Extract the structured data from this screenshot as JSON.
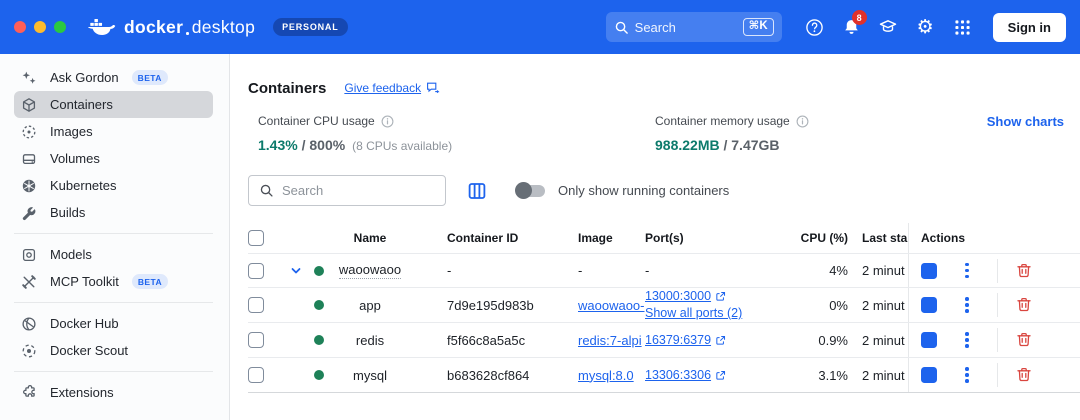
{
  "topbar": {
    "wordmark_bold": "docker",
    "wordmark_light": "desktop",
    "plan_badge": "PERSONAL",
    "search_placeholder": "Search",
    "search_shortcut": "⌘K",
    "notification_count": "8",
    "sign_in": "Sign in"
  },
  "sidebar": {
    "groups": [
      {
        "items": [
          {
            "label": "Ask Gordon",
            "icon": "sparkles",
            "badge": "BETA"
          },
          {
            "label": "Containers",
            "icon": "container-cube",
            "selected": true
          },
          {
            "label": "Images",
            "icon": "image-circle"
          },
          {
            "label": "Volumes",
            "icon": "volume-drive"
          },
          {
            "label": "Kubernetes",
            "icon": "kubernetes-wheel"
          },
          {
            "label": "Builds",
            "icon": "wrench"
          }
        ]
      },
      {
        "items": [
          {
            "label": "Models",
            "icon": "model-chip"
          },
          {
            "label": "MCP Toolkit",
            "icon": "tools",
            "badge": "BETA"
          }
        ]
      },
      {
        "items": [
          {
            "label": "Docker Hub",
            "icon": "docker-hub-globe"
          },
          {
            "label": "Docker Scout",
            "icon": "scout-target"
          }
        ]
      },
      {
        "items": [
          {
            "label": "Extensions",
            "icon": "puzzle"
          }
        ]
      }
    ]
  },
  "content": {
    "page_title": "Containers",
    "feedback_link": "Give feedback",
    "usage": {
      "cpu": {
        "label": "Container CPU usage",
        "value": "1.43%",
        "total": " / 800%",
        "note": "(8 CPUs available)"
      },
      "memory": {
        "label": "Container memory usage",
        "value": "988.22MB",
        "total": " / 7.47GB"
      },
      "show_charts": "Show charts"
    },
    "filters": {
      "search_placeholder": "Search",
      "running_only_label": "Only show running containers",
      "running_only_on": false
    },
    "table": {
      "headers": {
        "name": "Name",
        "container_id": "Container ID",
        "image": "Image",
        "ports": "Port(s)",
        "cpu": "CPU (%)",
        "last_started": "Last sta",
        "actions": "Actions"
      },
      "rows": [
        {
          "kind": "group",
          "expanded": true,
          "status": "running",
          "name": "waoowaoo",
          "container_id": "-",
          "image": "-",
          "image_is_link": false,
          "ports_dash": "-",
          "cpu": "4%",
          "last_started": "2 minut"
        },
        {
          "kind": "child",
          "status": "running",
          "name": "app",
          "container_id": "7d9e195d983b",
          "image": "waoowaoo-",
          "image_is_link": true,
          "ports": [
            "13000:3000"
          ],
          "ports_more": "Show all ports (2)",
          "cpu": "0%",
          "last_started": "2 minut"
        },
        {
          "kind": "child",
          "status": "running",
          "name": "redis",
          "container_id": "f5f66c8a5a5c",
          "image": "redis:7-alpi",
          "image_is_link": true,
          "ports": [
            "16379:6379"
          ],
          "cpu": "0.9%",
          "last_started": "2 minut"
        },
        {
          "kind": "child",
          "status": "running",
          "name": "mysql",
          "container_id": "b683628cf864",
          "image": "mysql:8.0",
          "image_is_link": true,
          "ports": [
            "13306:3306"
          ],
          "cpu": "3.1%",
          "last_started": "2 minut"
        }
      ]
    }
  },
  "colors": {
    "accent_blue": "#1d63ed",
    "usage_teal": "#0c7a6b",
    "running_green": "#1e8158",
    "danger_red": "#d9453f",
    "notification_red": "#e0312b"
  }
}
